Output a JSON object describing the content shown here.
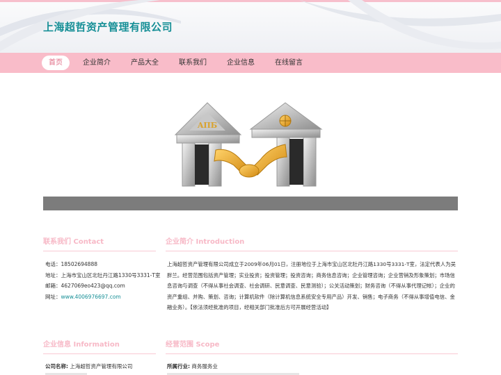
{
  "header": {
    "site_title": "上海超哲资产管理有限公司"
  },
  "nav": {
    "items": [
      {
        "label": "首页",
        "active": true
      },
      {
        "label": "企业简介",
        "active": false
      },
      {
        "label": "产品大全",
        "active": false
      },
      {
        "label": "联系我们",
        "active": false
      },
      {
        "label": "企业信息",
        "active": false
      },
      {
        "label": "在线留言",
        "active": false
      }
    ]
  },
  "banner": {
    "left_sign": "AПБ"
  },
  "contact": {
    "title": "联系我们 Contact",
    "phone_label": "电话：",
    "phone": "18502694888",
    "address_label": "地址：",
    "address": "上海市宝山区北牡丹江路1330号3331-T室",
    "email_label": "邮箱：",
    "email": "4627069eo423@qq.com",
    "website_label": "网址：",
    "website": "www.4006976697.com"
  },
  "intro": {
    "title": "企业简介 Introduction",
    "text": "上海超哲资产管理有限公司成立于2009年06月01日，注册地位于上海市宝山区北牡丹江路1330号3331-T室，法定代表人为吴胖兰。经营范围包括资产管理；实业投资；投资管理；投资咨询；商务信息咨询；企业管理咨询；企业营销及形象策划；市场信息咨询与调查（不得从事社会调查、社会调研、民意调查、民意测验）；公关活动策划；财务咨询（不得从事代理记帐）；企业的资产重组、并购、策划、咨询；计算机软件（除计算机信息系统安全专用产品）开发、销售；电子商务（不得从事增值电信、金融业务）。【依法须经批准的项目，经相关部门批准后方可开展经营活动】"
  },
  "info": {
    "title": "企业信息 Information",
    "company_label": "公司名称:",
    "company": "上海超哲资产管理有限公司"
  },
  "scope": {
    "title": "经营范围 Scope",
    "industry_label": "所属行业:",
    "industry": "商务服务业"
  }
}
